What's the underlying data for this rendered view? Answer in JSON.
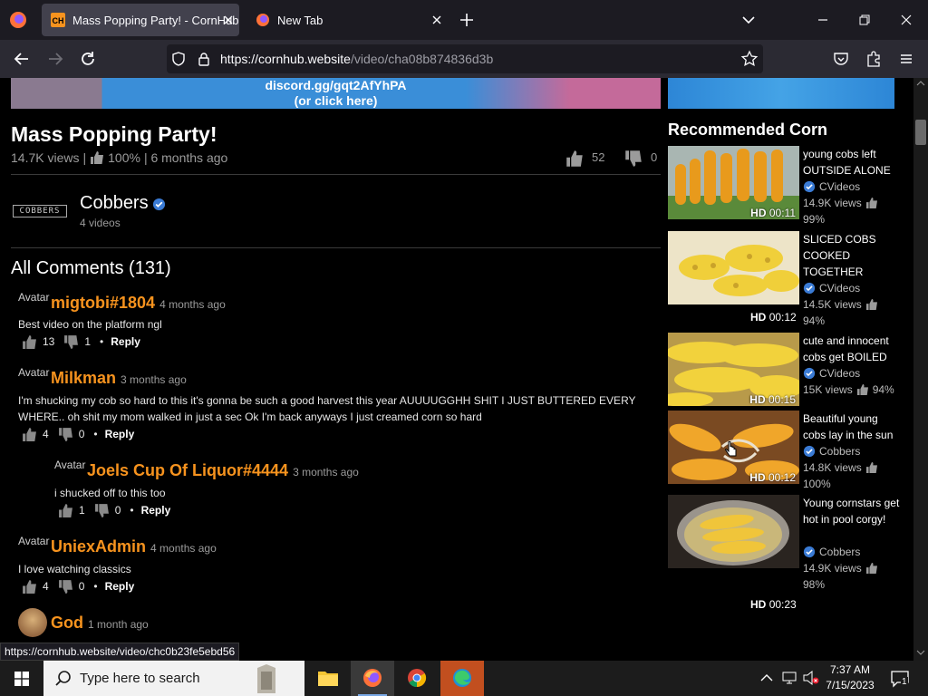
{
  "browser": {
    "tabs": [
      {
        "title": "Mass Popping Party! - CornHub",
        "favicon": "cornhub-favicon",
        "active": true
      },
      {
        "title": "New Tab",
        "favicon": "firefox-icon",
        "active": false
      }
    ],
    "url_domain": "https://cornhub.website",
    "url_path": "/video/cha08b874836d3b",
    "status_url": "https://cornhub.website/video/chc0b23fe5ebd56"
  },
  "banner": {
    "line1": "discord.gg/gqt2AfYhPA",
    "line2": "(or click here)"
  },
  "video": {
    "title": "Mass Popping Party!",
    "views": "14.7K views",
    "sep": "|",
    "rating": "100%",
    "age": "| 6 months ago",
    "likes": "52",
    "dislikes": "0"
  },
  "channel": {
    "logo_text": "COBBERS",
    "name": "Cobbers",
    "videos": "4 videos"
  },
  "comments_header": "All Comments (131)",
  "comments": [
    {
      "avatar": "Avatar",
      "user": "migtobi#1804",
      "time": "4 months ago",
      "text": "Best video on the platform ngl",
      "likes": "13",
      "dislikes": "1",
      "dot": "•",
      "reply": "Reply"
    },
    {
      "avatar": "Avatar",
      "user": "Milkman",
      "time": "3 months ago",
      "text": "I'm shucking my cob so hard to this it's gonna be such a good harvest this year AUUUUGGHH SHIT I JUST BUTTERED EVERY WHERE.. oh shit my mom walked in just a sec Ok I'm back anyways I just creamed corn so hard",
      "likes": "4",
      "dislikes": "0",
      "dot": "•",
      "reply": "Reply"
    },
    {
      "avatar": "Avatar",
      "user": "Joels Cup Of Liquor#4444",
      "time": "3 months ago",
      "text": "i shucked off to this too",
      "likes": "1",
      "dislikes": "0",
      "dot": "•",
      "reply": "Reply"
    },
    {
      "avatar": "Avatar",
      "user": "UniexAdmin",
      "time": "4 months ago",
      "text": "I love watching classics",
      "likes": "4",
      "dislikes": "0",
      "dot": "•",
      "reply": "Reply"
    },
    {
      "user": "God",
      "time": "1 month ago"
    }
  ],
  "sidebar": {
    "heading": "Recommended Corn",
    "items": [
      {
        "title": "young cobs left OUTSIDE ALONE",
        "channel": "CVideos",
        "views": "14.9K views",
        "rating": "99%",
        "hd": "HD",
        "duration": "00:11"
      },
      {
        "title": "SLICED COBS COOKED TOGETHER",
        "channel": "CVideos",
        "views": "14.5K views",
        "rating": "94%",
        "hd": "HD",
        "duration": "00:12"
      },
      {
        "title": "cute and innocent cobs get BOILED",
        "channel": "CVideos",
        "views": "15K views",
        "rating": "94%",
        "hd": "HD",
        "duration": "00:15"
      },
      {
        "title": "Beautiful young cobs lay in the sun",
        "channel": "Cobbers",
        "views": "14.8K views",
        "rating": "100%",
        "hd": "HD",
        "duration": "00:12"
      },
      {
        "title": "Young cornstars get hot in pool corgy!",
        "channel": "Cobbers",
        "views": "14.9K views",
        "rating": "98%",
        "hd": "HD",
        "duration": "00:23"
      }
    ]
  },
  "taskbar": {
    "search_placeholder": "Type here to search",
    "time": "7:37 AM",
    "date": "7/15/2023",
    "notifications": "1"
  },
  "colors": {
    "accent": "#f7931e",
    "verified": "#3a7bd5"
  }
}
